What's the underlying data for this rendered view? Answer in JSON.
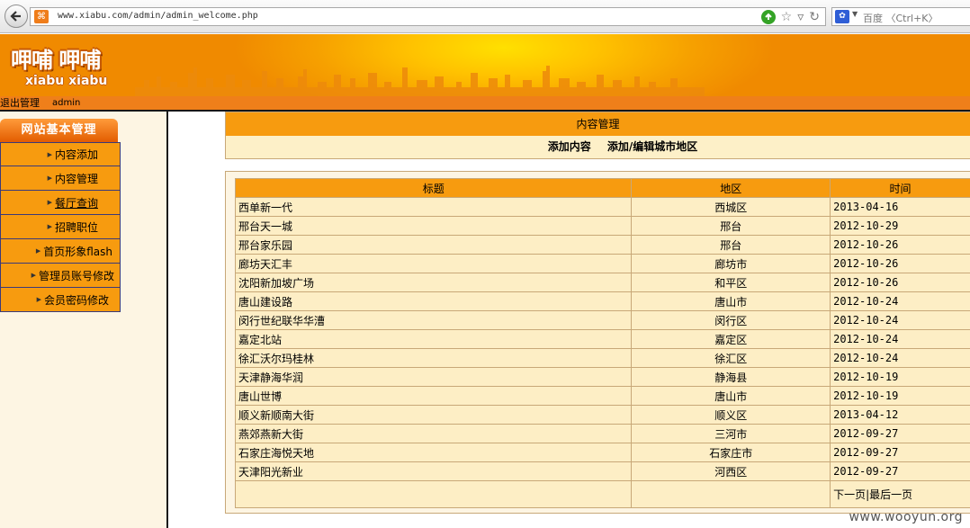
{
  "browser": {
    "url": "www.xiabu.com/admin/admin_welcome.php",
    "site_icon": "xampp-icon",
    "search_engine_icon": "paw-icon",
    "search_placeholder": "百度 〈Ctrl+K〉"
  },
  "header": {
    "logo_cn": "呷哺 呷哺",
    "logo_en": "xiabu xiabu",
    "logout_label": "退出管理",
    "username": "admin"
  },
  "sidebar": {
    "title": "网站基本管理",
    "items": [
      {
        "label": "内容添加"
      },
      {
        "label": "内容管理"
      },
      {
        "label": "餐厅查询"
      },
      {
        "label": "招聘职位"
      },
      {
        "label": "首页形象flash"
      },
      {
        "label": "管理员账号修改"
      },
      {
        "label": "会员密码修改"
      }
    ]
  },
  "content": {
    "header": "内容管理",
    "actions": {
      "add_content": "添加内容",
      "add_edit_region": "添加/编辑城市地区"
    },
    "table": {
      "columns": {
        "title": "标题",
        "region": "地区",
        "time": "时间"
      },
      "rows": [
        {
          "title": "西单新一代",
          "region": "西城区",
          "time": "2013-04-16"
        },
        {
          "title": "邢台天一城",
          "region": "邢台",
          "time": "2012-10-29"
        },
        {
          "title": "邢台家乐园",
          "region": "邢台",
          "time": "2012-10-26"
        },
        {
          "title": "廊坊天汇丰",
          "region": "廊坊市",
          "time": "2012-10-26"
        },
        {
          "title": "沈阳新加坡广场",
          "region": "和平区",
          "time": "2012-10-26"
        },
        {
          "title": "唐山建设路",
          "region": "唐山市",
          "time": "2012-10-24"
        },
        {
          "title": "闵行世纪联华华漕",
          "region": "闵行区",
          "time": "2012-10-24"
        },
        {
          "title": "嘉定北站",
          "region": "嘉定区",
          "time": "2012-10-24"
        },
        {
          "title": "徐汇沃尔玛桂林",
          "region": "徐汇区",
          "time": "2012-10-24"
        },
        {
          "title": "天津静海华润",
          "region": "静海县",
          "time": "2012-10-19"
        },
        {
          "title": "唐山世博",
          "region": "唐山市",
          "time": "2012-10-19"
        },
        {
          "title": "顺义新顺南大街",
          "region": "顺义区",
          "time": "2013-04-12"
        },
        {
          "title": "燕郊燕新大街",
          "region": "三河市",
          "time": "2012-09-27"
        },
        {
          "title": "石家庄海悦天地",
          "region": "石家庄市",
          "time": "2012-09-27"
        },
        {
          "title": "天津阳光新业",
          "region": "河西区",
          "time": "2012-09-27"
        }
      ]
    },
    "pager": {
      "next": "下一页",
      "separator": "|",
      "last": "最后一页"
    }
  },
  "watermark": "www.wooyun.org",
  "colors": {
    "menu_orange": "#f79b0f",
    "subbar_orange": "#ef7f1a",
    "row_bg": "#fdeec5",
    "panel_bg": "#fdf5e3"
  }
}
